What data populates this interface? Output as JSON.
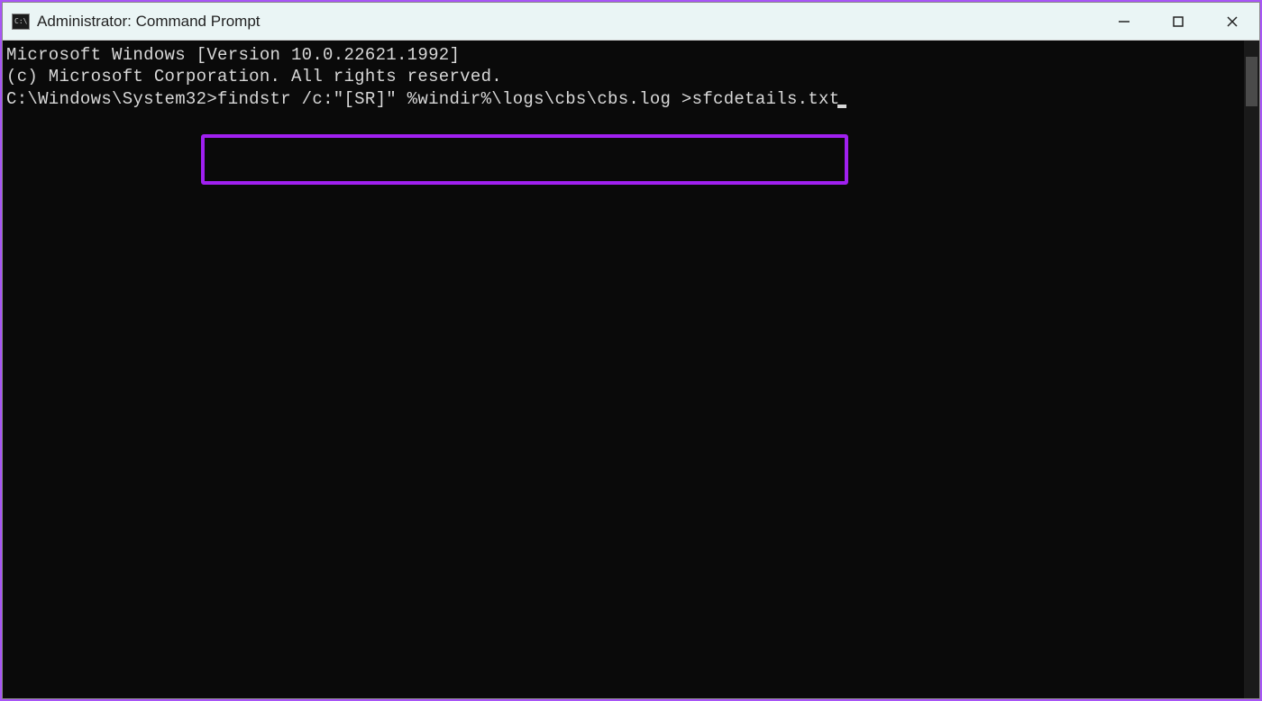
{
  "titlebar": {
    "title": "Administrator: Command Prompt",
    "icon_label": "C:\\"
  },
  "terminal": {
    "line1": "Microsoft Windows [Version 10.0.22621.1992]",
    "line2": "(c) Microsoft Corporation. All rights reserved.",
    "blank": "",
    "prompt": "C:\\Windows\\System32>",
    "command": "findstr /c:\"[SR]\" %windir%\\logs\\cbs\\cbs.log >sfcdetails.txt"
  },
  "colors": {
    "highlight": "#a020f0",
    "titlebar_bg": "#eaf5f5",
    "terminal_bg": "#0a0a0a",
    "terminal_fg": "#d8d8d8"
  }
}
